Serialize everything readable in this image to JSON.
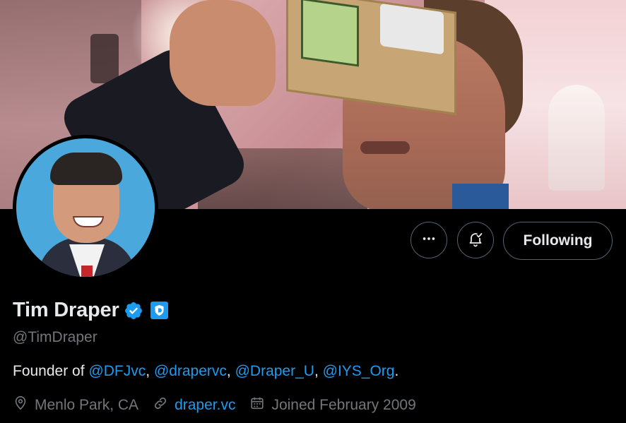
{
  "profile": {
    "name": "Tim Draper",
    "handle": "@TimDraper",
    "bio_prefix": "Founder of ",
    "bio_links": [
      "@DFJvc",
      "@drapervc",
      "@Draper_U",
      "@IYS_Org"
    ],
    "bio_separator": ", ",
    "bio_suffix": ".",
    "location": "Menlo Park, CA",
    "website": "draper.vc",
    "joined": "Joined February 2009"
  },
  "actions": {
    "follow_label": "Following"
  },
  "icons": {
    "more": "more-horizontal-icon",
    "notify": "bell-check-icon",
    "verified": "verified-badge-icon",
    "gov": "government-badge-icon",
    "location": "location-pin-icon",
    "link": "link-icon",
    "calendar": "calendar-icon"
  },
  "colors": {
    "accent": "#1d9bf0",
    "text_primary": "#e7e9ea",
    "text_secondary": "#71767b",
    "border": "#536471",
    "background": "#000000"
  }
}
